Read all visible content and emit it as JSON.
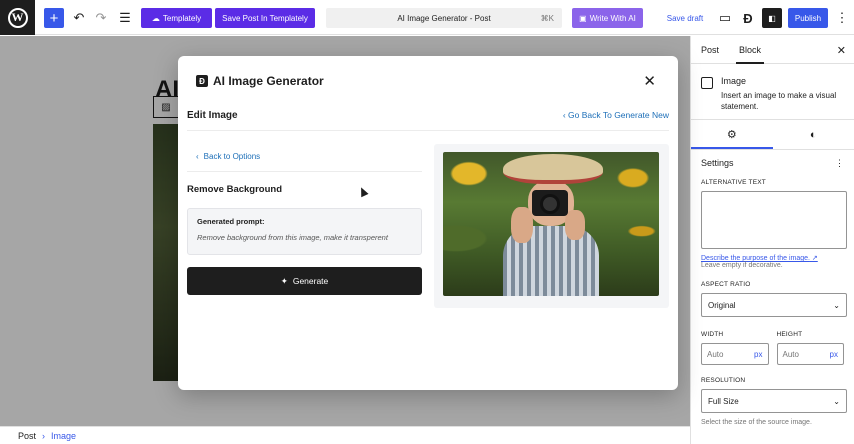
{
  "topbar": {
    "templately_label": "Templately",
    "save_templately_label": "Save Post In Templately",
    "doc_title": "AI Image Generator - Post",
    "doc_shortcut": "⌘K",
    "write_ai_label": "Write With AI",
    "save_draft_label": "Save draft",
    "publish_label": "Publish"
  },
  "canvas": {
    "heading_fragment": "AI"
  },
  "footer": {
    "crumbs": [
      "Post",
      "Image"
    ],
    "separator": "›"
  },
  "sidebar": {
    "tabs": [
      "Post",
      "Block"
    ],
    "active_tab": "Block",
    "block_name": "Image",
    "block_description": "Insert an image to make a visual statement.",
    "settings_title": "Settings",
    "alt_text_label": "ALTERNATIVE TEXT",
    "alt_text_link": "Describe the purpose of the image.",
    "alt_text_help": "Leave empty if decorative.",
    "aspect_ratio_label": "ASPECT RATIO",
    "aspect_ratio_value": "Original",
    "width_label": "WIDTH",
    "height_label": "HEIGHT",
    "width_placeholder": "Auto",
    "height_placeholder": "Auto",
    "unit": "px",
    "resolution_label": "RESOLUTION",
    "resolution_value": "Full Size",
    "resolution_help": "Select the size of the source image."
  },
  "modal": {
    "title": "AI Image Generator",
    "edit_label": "Edit Image",
    "back_generate_label": "Go Back To Generate New",
    "back_options_label": "Back to Options",
    "section_title": "Remove Background",
    "prompt_label": "Generated prompt:",
    "prompt_text": "Remove background from this image, make it transperent",
    "generate_label": "Generate"
  },
  "colors": {
    "accent": "#3858e9",
    "templately": "#5b2ce6",
    "dark": "#1e1e1e"
  }
}
